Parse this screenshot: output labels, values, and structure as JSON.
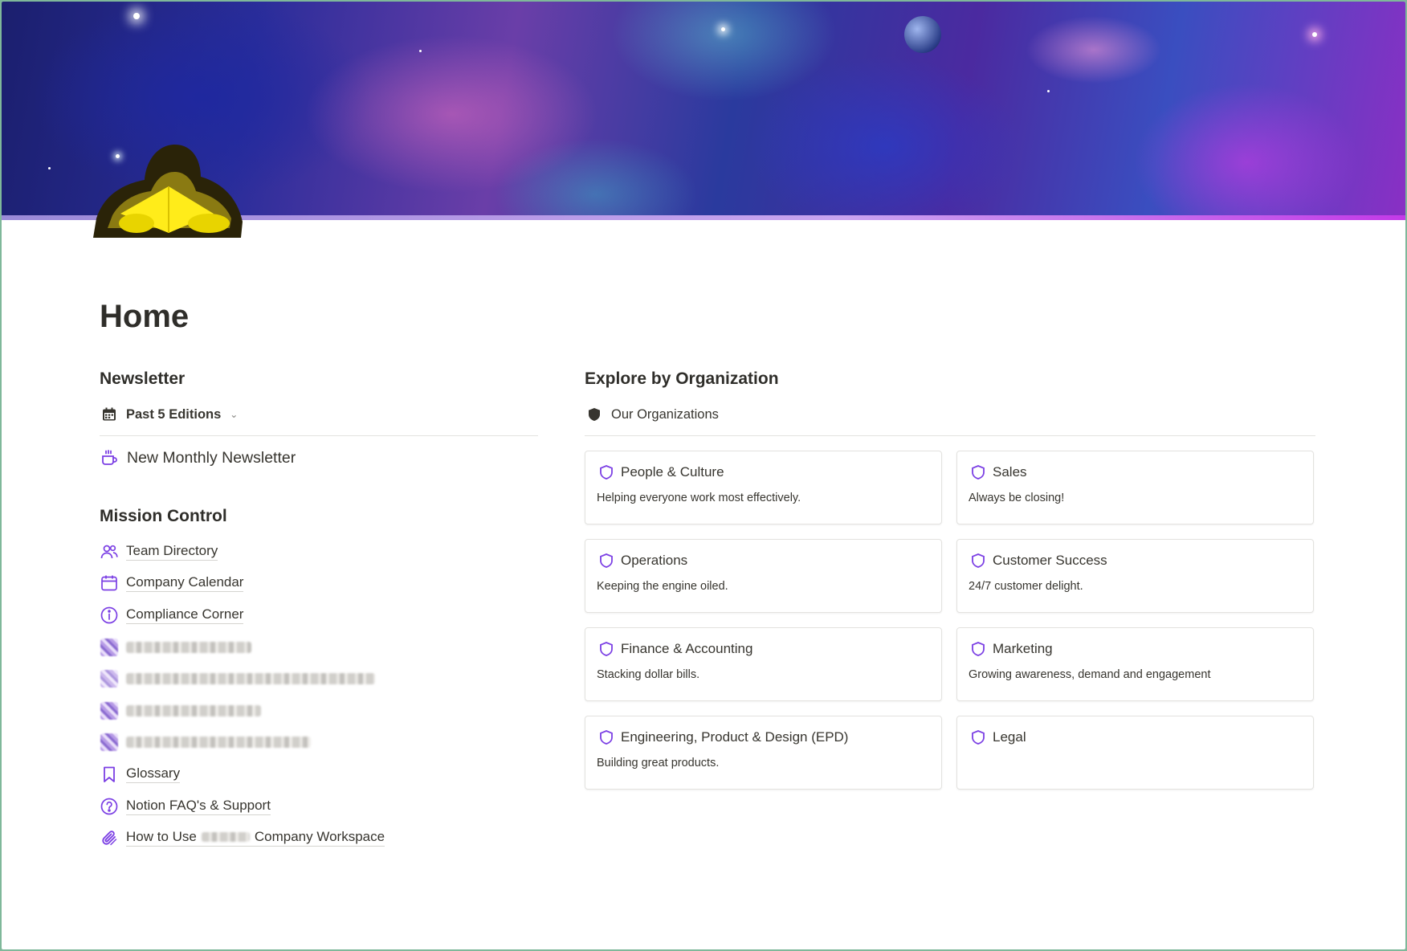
{
  "page": {
    "title": "Home"
  },
  "colors": {
    "accent_purple": "#7b3fe4",
    "text": "#37352f",
    "divider": "#e3e2df",
    "page_icon_yellow": "#f6e200"
  },
  "newsletter": {
    "heading": "Newsletter",
    "view_label": "Past 5 Editions",
    "view_icon": "calendar-icon",
    "items": [
      {
        "label": "New Monthly Newsletter",
        "icon": "coffee-cup-icon"
      }
    ]
  },
  "mission_control": {
    "heading": "Mission Control",
    "items": [
      {
        "label": "Team Directory",
        "icon": "people-icon"
      },
      {
        "label": "Company Calendar",
        "icon": "calendar-icon"
      },
      {
        "label": "Compliance Corner",
        "icon": "info-icon"
      },
      {
        "label": "",
        "icon": "redacted-icon",
        "redacted": true
      },
      {
        "label": "",
        "icon": "redacted-icon",
        "redacted": true
      },
      {
        "label": "",
        "icon": "redacted-icon",
        "redacted": true
      },
      {
        "label": "",
        "icon": "redacted-icon",
        "redacted": true
      },
      {
        "label": "Glossary",
        "icon": "bookmark-icon"
      },
      {
        "label": "Notion FAQ's & Support",
        "icon": "question-icon"
      },
      {
        "label_prefix": "How to Use",
        "label_suffix": "Company Workspace",
        "icon": "paperclip-icon"
      }
    ]
  },
  "organizations": {
    "heading": "Explore by Organization",
    "view_label": "Our Organizations",
    "view_icon": "shield-filled-icon",
    "cards": [
      {
        "name": "People & Culture",
        "description": "Helping everyone work most effectively."
      },
      {
        "name": "Sales",
        "description": "Always be closing!"
      },
      {
        "name": "Operations",
        "description": "Keeping the engine oiled."
      },
      {
        "name": "Customer Success",
        "description": "24/7 customer delight."
      },
      {
        "name": "Finance & Accounting",
        "description": "Stacking dollar bills."
      },
      {
        "name": "Marketing",
        "description": "Growing awareness, demand and engagement"
      },
      {
        "name": "Engineering, Product & Design (EPD)",
        "description": "Building great products."
      },
      {
        "name": "Legal",
        "description": ""
      }
    ]
  }
}
